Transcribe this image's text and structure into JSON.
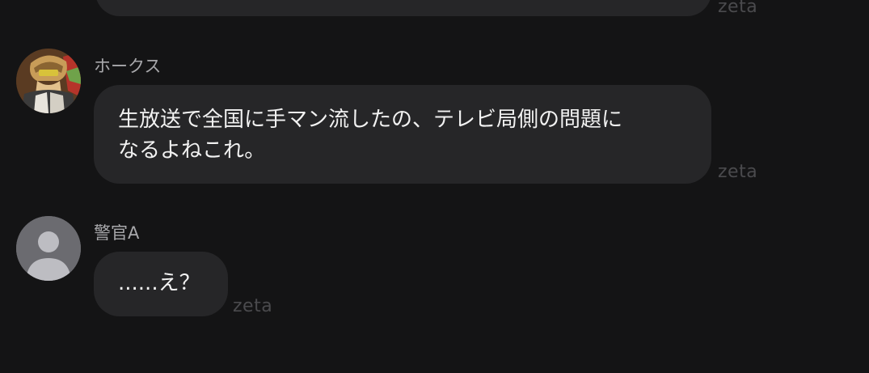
{
  "messages": [
    {
      "sender": "",
      "text": "",
      "watermark": "zeta"
    },
    {
      "sender": "ホークス",
      "avatar_icon": "character-avatar",
      "text": "生放送で全国に手マン流したの、テレビ局側の問題に\nなるよねこれ。",
      "watermark": "zeta"
    },
    {
      "sender": "警官A",
      "avatar_icon": "default-user-avatar",
      "text": "......え？",
      "watermark": "zeta"
    }
  ],
  "colors": {
    "background": "#141415",
    "bubble": "#262628",
    "text": "#f2f2f2",
    "sender": "#a8a8ab",
    "watermark": "#4a4a4d"
  }
}
